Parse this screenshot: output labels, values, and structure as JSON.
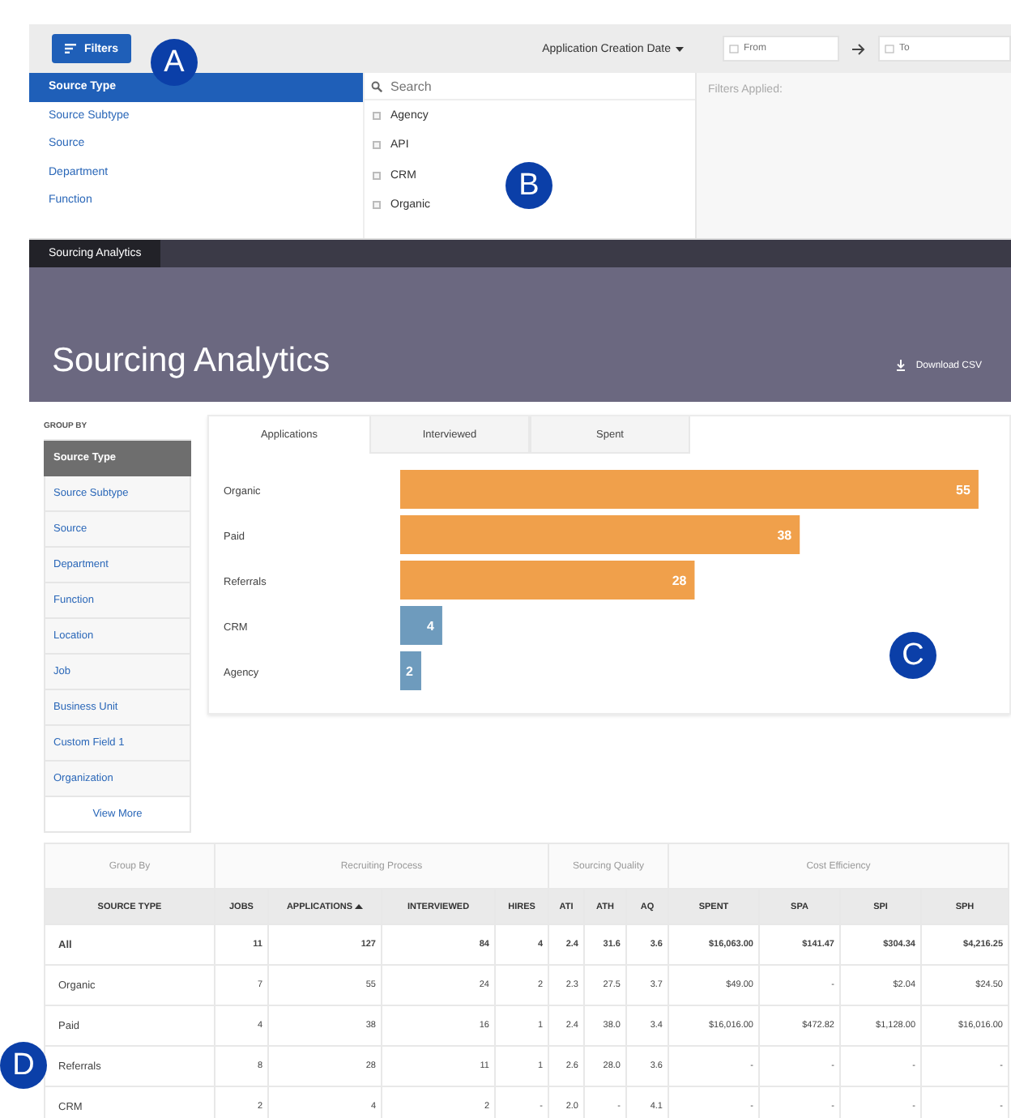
{
  "toolbar": {
    "filters_button": "Filters",
    "date_filter": "Application Creation Date",
    "from": {
      "placeholder": "From"
    },
    "to": {
      "placeholder": "To"
    }
  },
  "filter_panel": {
    "categories": [
      {
        "label": "Source Type",
        "selected": true
      },
      {
        "label": "Source Subtype",
        "selected": false
      },
      {
        "label": "Source",
        "selected": false
      },
      {
        "label": "Department",
        "selected": false
      },
      {
        "label": "Function",
        "selected": false
      }
    ],
    "search": {
      "placeholder": "Search"
    },
    "options": [
      {
        "label": "Agency",
        "checked": false
      },
      {
        "label": "API",
        "checked": false
      },
      {
        "label": "CRM",
        "checked": false
      },
      {
        "label": "Organic",
        "checked": false
      }
    ],
    "applied_label": "Filters Applied:"
  },
  "nav_tab": "Sourcing Analytics",
  "header": {
    "title": "Sourcing Analytics",
    "download": "Download CSV"
  },
  "group_by": {
    "label": "GROUP BY",
    "items": [
      {
        "label": "Source Type",
        "selected": true
      },
      {
        "label": "Source Subtype",
        "selected": false
      },
      {
        "label": "Source",
        "selected": false
      },
      {
        "label": "Department",
        "selected": false
      },
      {
        "label": "Function",
        "selected": false
      },
      {
        "label": "Location",
        "selected": false
      },
      {
        "label": "Job",
        "selected": false
      },
      {
        "label": "Business Unit",
        "selected": false
      },
      {
        "label": "Custom Field 1",
        "selected": false
      },
      {
        "label": "Organization",
        "selected": false
      }
    ],
    "more": "View More"
  },
  "chart_tabs": [
    {
      "label": "Applications",
      "selected": true
    },
    {
      "label": "Interviewed",
      "selected": false
    },
    {
      "label": "Spent",
      "selected": false
    }
  ],
  "chart_data": {
    "type": "bar",
    "orientation": "horizontal",
    "stacked": true,
    "data_labels": true,
    "categories": [
      "Organic",
      "Paid",
      "Referrals",
      "CRM",
      "Agency"
    ],
    "series": [
      {
        "color": "#f0a04b",
        "values": [
          55,
          38,
          28,
          null,
          null
        ]
      },
      {
        "color": "#6e9bbd",
        "values": [
          null,
          null,
          null,
          4,
          2
        ]
      }
    ]
  },
  "table": {
    "column_groups": [
      {
        "label": "Group By"
      },
      {
        "label": "Recruiting Process"
      },
      {
        "label": "Sourcing Quality"
      },
      {
        "label": "Cost Efficiency"
      }
    ],
    "columns": [
      {
        "label": "SOURCE TYPE",
        "sorted": false
      },
      {
        "label": "JOBS",
        "sorted": false
      },
      {
        "label": "APPLICATIONS",
        "sorted": true
      },
      {
        "label": "INTERVIEWED",
        "sorted": false
      },
      {
        "label": "HIRES",
        "sorted": false
      },
      {
        "label": "ATI",
        "sorted": false
      },
      {
        "label": "ATH",
        "sorted": false
      },
      {
        "label": "AQ",
        "sorted": false
      },
      {
        "label": "SPENT",
        "sorted": false
      },
      {
        "label": "SPA",
        "sorted": false
      },
      {
        "label": "SPI",
        "sorted": false
      },
      {
        "label": "SPH",
        "sorted": false
      }
    ],
    "rows": [
      {
        "kind": "total",
        "cells": [
          "All",
          "11",
          "127",
          "84",
          "4",
          "2.4",
          "31.6",
          "3.6",
          "$16,063.00",
          "$141.47",
          "$304.34",
          "$4,216.25"
        ]
      },
      {
        "kind": "row",
        "cells": [
          "Organic",
          "7",
          "55",
          "24",
          "2",
          "2.3",
          "27.5",
          "3.7",
          "$49.00",
          "-",
          "$2.04",
          "$24.50"
        ]
      },
      {
        "kind": "row",
        "cells": [
          "Paid",
          "4",
          "38",
          "16",
          "1",
          "2.4",
          "38.0",
          "3.4",
          "$16,016.00",
          "$472.82",
          "$1,128.00",
          "$16,016.00"
        ]
      },
      {
        "kind": "row",
        "cells": [
          "Referrals",
          "8",
          "28",
          "11",
          "1",
          "2.6",
          "28.0",
          "3.6",
          "-",
          "-",
          "-",
          "-"
        ]
      },
      {
        "kind": "row",
        "cells": [
          "CRM",
          "2",
          "4",
          "2",
          "-",
          "2.0",
          "-",
          "4.1",
          "-",
          "-",
          "-",
          "-"
        ]
      }
    ]
  },
  "callouts": [
    "A",
    "B",
    "C",
    "D"
  ]
}
